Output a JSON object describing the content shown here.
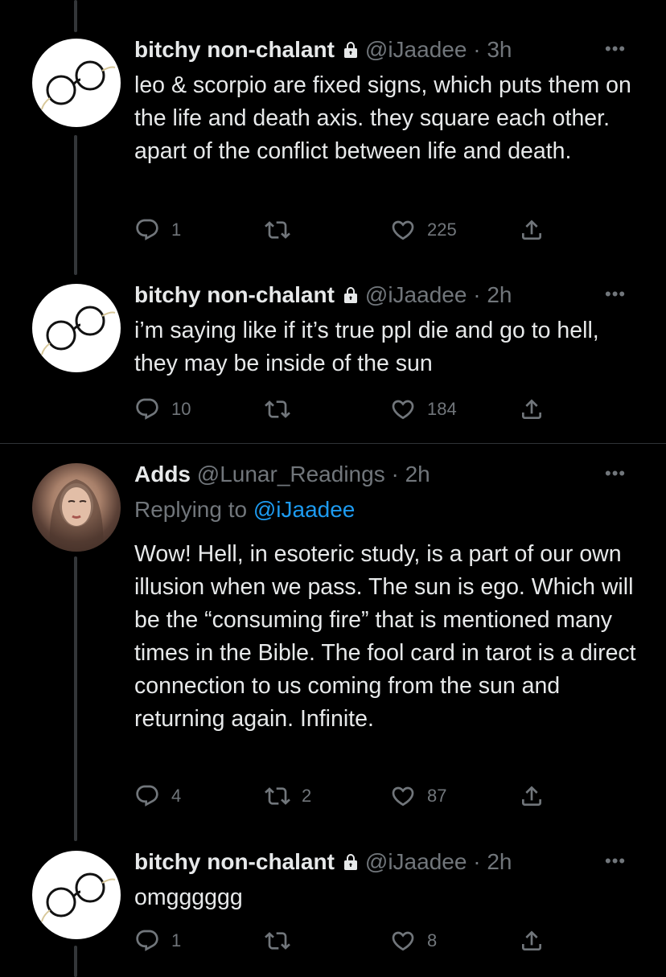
{
  "tweets": [
    {
      "name": "bitchy non-chalant",
      "handle": "@iJaadee",
      "sep": "·",
      "time": "3h",
      "text": "leo & scorpio are fixed signs, which puts them on the life and death axis. they square each other. apart of the conflict between life and death.",
      "replies": "1",
      "retweets": "",
      "likes": "225"
    },
    {
      "name": "bitchy non-chalant",
      "handle": "@iJaadee",
      "sep": "·",
      "time": "2h",
      "text": "i’m saying like if it’s true ppl die and go to hell, they may be inside of the sun",
      "replies": "10",
      "retweets": "",
      "likes": "184"
    },
    {
      "name": "Adds",
      "handle": "@Lunar_Readings",
      "sep": "·",
      "time": "2h",
      "replying_label": "Replying to",
      "replying_to": "@iJaadee",
      "text": "Wow! Hell, in esoteric study, is a part of our own illusion when we pass. The sun is ego. Which will be the “consuming fire” that is mentioned many times in the Bible. The fool card in tarot is a direct connection to us coming from the sun and returning again. Infinite.",
      "replies": "4",
      "retweets": "2",
      "likes": "87"
    },
    {
      "name": "bitchy non-chalant",
      "handle": "@iJaadee",
      "sep": "·",
      "time": "2h",
      "text": "omgggggg",
      "replies": "1",
      "retweets": "",
      "likes": "8"
    }
  ],
  "icons": {
    "reply": "reply-icon",
    "retweet": "retweet-icon",
    "like": "heart-icon",
    "share": "share-icon",
    "more": "more-icon",
    "lock": "lock-icon"
  },
  "colors": {
    "background": "#000000",
    "text": "#e7e9ea",
    "muted": "#71767b",
    "link": "#1d9bf0",
    "thread_line": "#333639"
  }
}
